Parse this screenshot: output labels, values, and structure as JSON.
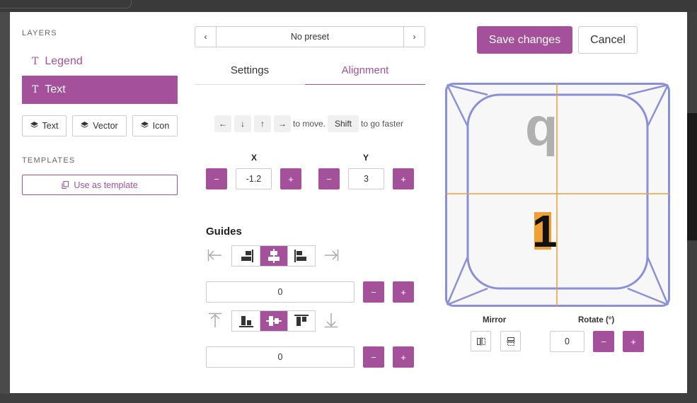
{
  "layers": {
    "section_label": "LAYERS",
    "items": [
      {
        "label": "Legend",
        "icon": "T",
        "active": false
      },
      {
        "label": "Text",
        "icon": "T",
        "active": true
      }
    ],
    "add_buttons": [
      {
        "label": "Text",
        "icon": "layers-icon"
      },
      {
        "label": "Vector",
        "icon": "layers-icon"
      },
      {
        "label": "Icon",
        "icon": "layers-icon"
      }
    ]
  },
  "templates": {
    "section_label": "TEMPLATES",
    "use_template_label": "Use as template"
  },
  "preset": {
    "prev": "‹",
    "label": "No preset",
    "next": "›"
  },
  "tabs": [
    {
      "label": "Settings",
      "active": false
    },
    {
      "label": "Alignment",
      "active": true
    }
  ],
  "move_hint": {
    "keys": [
      "←",
      "↓",
      "↑",
      "→"
    ],
    "to_move": "to move.",
    "shift_key": "Shift",
    "to_go_faster": "to go faster"
  },
  "position": {
    "x_label": "X",
    "x_value": "-1.2",
    "y_label": "Y",
    "y_value": "3",
    "minus": "−",
    "plus": "+"
  },
  "guides": {
    "title": "Guides",
    "horizontal_value": "0",
    "vertical_value": "0",
    "horizontal_active_index": 1,
    "vertical_active_index": 1
  },
  "actions": {
    "save_label": "Save changes",
    "cancel_label": "Cancel"
  },
  "preview": {
    "top_legend": "q",
    "main_legend": "1",
    "outline_color": "#8b8fd8",
    "guide_color": "#e8a13a",
    "highlight_color": "#f0a030"
  },
  "transform": {
    "mirror_label": "Mirror",
    "rotate_label": "Rotate (°)",
    "rotate_value": "0",
    "minus": "−",
    "plus": "+"
  },
  "colors": {
    "accent": "#a5509a"
  }
}
